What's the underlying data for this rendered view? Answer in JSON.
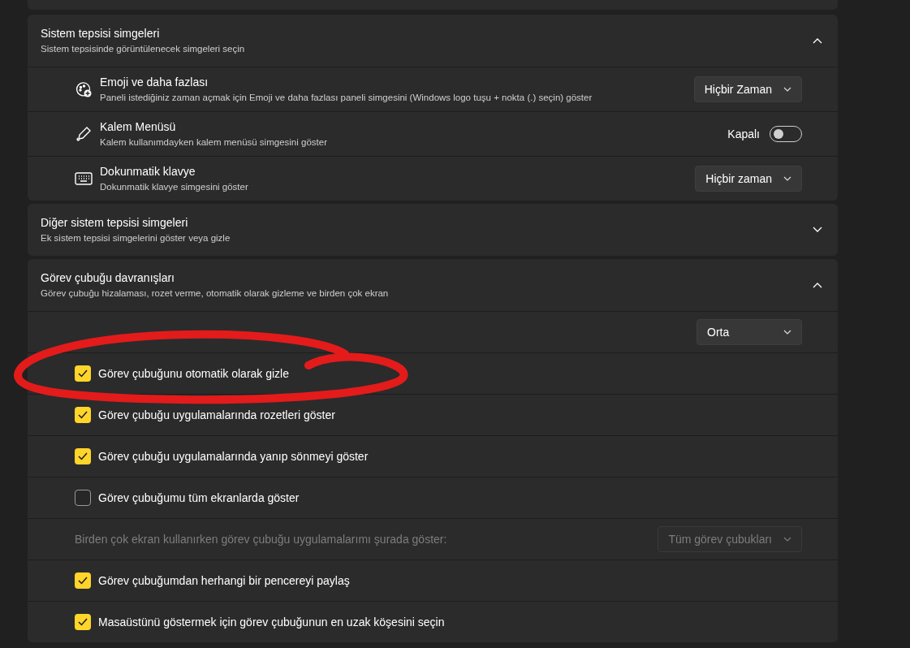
{
  "sections": [
    {
      "title": "Sistem tepsisi simgeleri",
      "subtitle": "Sistem tepsisinde görüntülenecek simgeleri seçin",
      "expanded": true,
      "rows": [
        {
          "kind": "dropdown",
          "title": "Emoji ve daha fazlası",
          "description": "Paneli istediğiniz zaman açmak için Emoji ve daha fazlası paneli simgesini (Windows logo tuşu + nokta (.) seçin) göster",
          "value": "Hiçbir Zaman"
        },
        {
          "kind": "toggle",
          "title": "Kalem Menüsü",
          "description": "Kalem kullanımdayken kalem menüsü simgesini göster",
          "value": "Kapalı",
          "on": false
        },
        {
          "kind": "dropdown",
          "title": "Dokunmatik klavye",
          "description": "Dokunmatik klavye simgesini göster",
          "value": "Hiçbir zaman"
        }
      ]
    },
    {
      "title": "Diğer sistem tepsisi simgeleri",
      "subtitle": "Ek sistem tepsisi simgelerini göster veya gizle",
      "expanded": false
    },
    {
      "title": "Görev çubuğu davranışları",
      "subtitle": "Görev çubuğu hizalaması, rozet verme, otomatik olarak gizleme ve birden çok ekran",
      "expanded": true,
      "rows": [
        {
          "kind": "dropdown",
          "value": "Orta"
        },
        {
          "kind": "checkbox",
          "title": "Görev çubuğunu otomatik olarak gizle",
          "checked": true
        },
        {
          "kind": "checkbox",
          "title": "Görev çubuğu uygulamalarında rozetleri göster",
          "checked": true
        },
        {
          "kind": "checkbox",
          "title": "Görev çubuğu uygulamalarında yanıp sönmeyi göster",
          "checked": true
        },
        {
          "kind": "checkbox",
          "title": "Görev çubuğumu tüm ekranlarda göster",
          "checked": false
        },
        {
          "kind": "dropdown",
          "title": "Birden çok ekran kullanırken görev çubuğu uygulamalarımı şurada göster:",
          "value": "Tüm görev çubukları",
          "disabled": true
        },
        {
          "kind": "checkbox",
          "title": "Görev çubuğumdan herhangi bir pencereyi paylaş",
          "checked": true
        },
        {
          "kind": "checkbox",
          "title": "Masaüstünü göstermek için görev çubuğunun en uzak köşesini seçin",
          "checked": true
        }
      ]
    }
  ]
}
